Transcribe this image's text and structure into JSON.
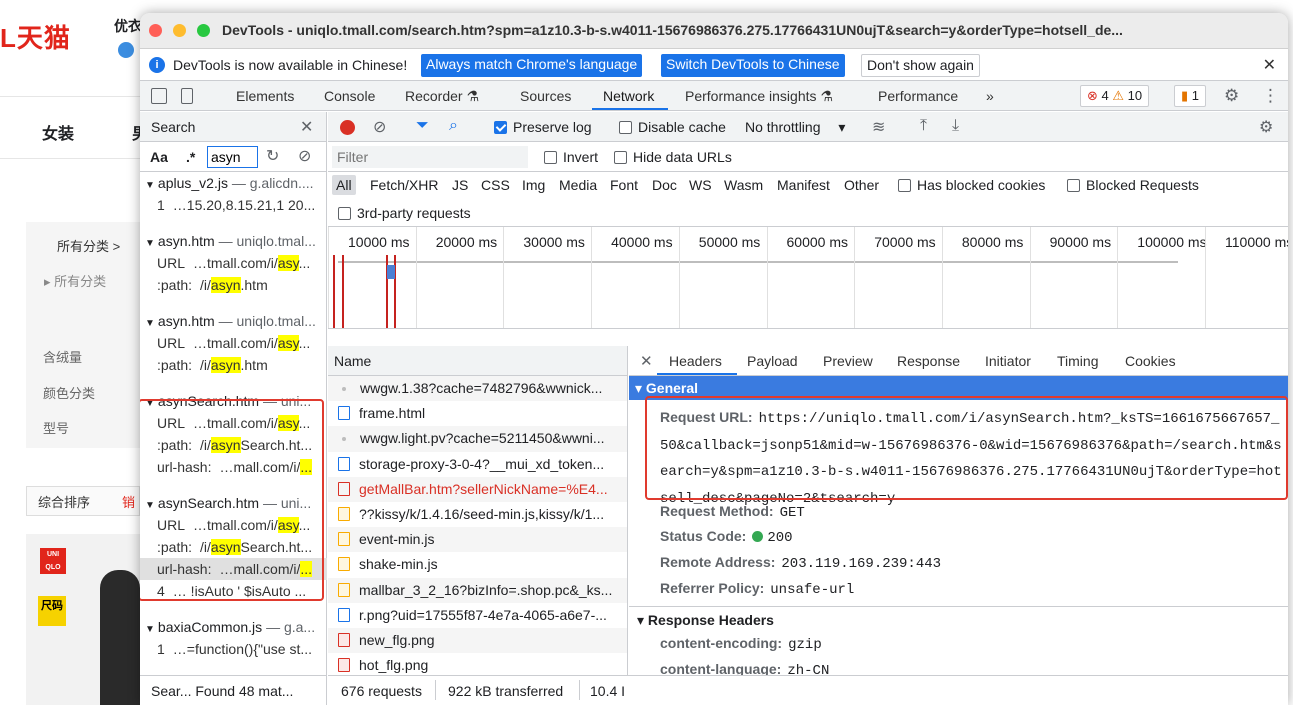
{
  "background": {
    "logo": "L天猫",
    "shop_name": "优衣",
    "nav": [
      "女装",
      "男"
    ],
    "category_title": "所有分类 >",
    "category_all": "所有分类",
    "filters": [
      "含绒量",
      "颜色分类",
      "型号"
    ],
    "sort_default": "综合排序",
    "sort_sales": "销",
    "product_tag": "尺码",
    "brand_badge": "UNI QLO"
  },
  "window": {
    "title": "DevTools - uniqlo.tmall.com/search.htm?spm=a1z10.3-b-s.w4011-15676986376.275.17766431UN0ujT&search=y&orderType=hotsell_de..."
  },
  "infobar": {
    "message": "DevTools is now available in Chinese!",
    "btn_match": "Always match Chrome's language",
    "btn_switch": "Switch DevTools to Chinese",
    "btn_dismiss": "Don't show again"
  },
  "tabs": {
    "items": [
      "Elements",
      "Console",
      "Recorder ⚗",
      "Sources",
      "Network",
      "Performance insights ⚗",
      "Performance"
    ],
    "more": "»",
    "errors": "4",
    "warnings": "10",
    "issues": "1"
  },
  "search": {
    "title": "Search",
    "aa": "Aa",
    "regex": ".*",
    "query": "asyn",
    "footer": "Sear...   Found 48 mat...",
    "results": [
      {
        "file": "aplus_v2.js",
        "url": "g.alicdn....",
        "lines": [
          {
            "k": "1",
            "pre": "…15.20,8.15.21,1 20...",
            "hl": "",
            "post": ""
          }
        ]
      },
      {
        "file": "asyn.htm",
        "url": "uniqlo.tmal...",
        "lines": [
          {
            "k": "URL",
            "pre": "…tmall.com/i/",
            "hl": "asy",
            "post": "..."
          },
          {
            "k": ":path:",
            "pre": "/i/",
            "hl": "asyn",
            "post": ".htm"
          }
        ]
      },
      {
        "file": "asyn.htm",
        "url": "uniqlo.tmal...",
        "lines": [
          {
            "k": "URL",
            "pre": "…tmall.com/i/",
            "hl": "asy",
            "post": "..."
          },
          {
            "k": ":path:",
            "pre": "/i/",
            "hl": "asyn",
            "post": ".htm"
          }
        ]
      },
      {
        "file": "asynSearch.htm",
        "url": "uni...",
        "lines": [
          {
            "k": "URL",
            "pre": "…tmall.com/i/",
            "hl": "asy",
            "post": "..."
          },
          {
            "k": ":path:",
            "pre": "/i/",
            "hl": "asyn",
            "post": "Search.ht..."
          },
          {
            "k": "url-hash:",
            "pre": "…mall.com/i/",
            "hl": "...",
            "post": ""
          }
        ]
      },
      {
        "file": "asynSearch.htm",
        "url": "uni...",
        "lines": [
          {
            "k": "URL",
            "pre": "…tmall.com/i/",
            "hl": "asy",
            "post": "..."
          },
          {
            "k": ":path:",
            "pre": "/i/",
            "hl": "asyn",
            "post": "Search.ht..."
          },
          {
            "k": "url-hash:",
            "pre": "…mall.com/i/",
            "hl": "...",
            "post": ""
          },
          {
            "k": "4",
            "pre": "… !isAuto ' $isAuto ...",
            "hl": "",
            "post": ""
          }
        ]
      },
      {
        "file": "baxiaCommon.js",
        "url": "g.a...",
        "lines": [
          {
            "k": "1",
            "pre": "…=function(){\"use st...",
            "hl": "",
            "post": ""
          }
        ]
      }
    ]
  },
  "network": {
    "preserve_log": "Preserve log",
    "disable_cache": "Disable cache",
    "throttling": "No throttling",
    "filter_placeholder": "Filter",
    "invert": "Invert",
    "hide_data": "Hide data URLs",
    "types": [
      "All",
      "Fetch/XHR",
      "JS",
      "CSS",
      "Img",
      "Media",
      "Font",
      "Doc",
      "WS",
      "Wasm",
      "Manifest",
      "Other"
    ],
    "blocked_cookies": "Has blocked cookies",
    "blocked_requests": "Blocked Requests",
    "third_party": "3rd-party requests",
    "ticks": [
      "10000 ms",
      "20000 ms",
      "30000 ms",
      "40000 ms",
      "50000 ms",
      "60000 ms",
      "70000 ms",
      "80000 ms",
      "90000 ms",
      "100000 ms",
      "110000 ms"
    ],
    "name_header": "Name",
    "requests": [
      {
        "type": "dot",
        "name": "wwgw.1.38?cache=7482796&wwnick..."
      },
      {
        "type": "doc",
        "name": "frame.html"
      },
      {
        "type": "dot",
        "name": "wwgw.light.pv?cache=5211450&wwni..."
      },
      {
        "type": "doc",
        "name": "storage-proxy-3-0-4?__mui_xd_token..."
      },
      {
        "type": "xhr",
        "name": "getMallBar.htm?sellerNickName=%E4...",
        "error": true
      },
      {
        "type": "js",
        "name": "??kissy/k/1.4.16/seed-min.js,kissy/k/1..."
      },
      {
        "type": "js",
        "name": "event-min.js"
      },
      {
        "type": "js",
        "name": "shake-min.js"
      },
      {
        "type": "js",
        "name": "mallbar_3_2_16?bizInfo=.shop.pc&_ks..."
      },
      {
        "type": "doc",
        "name": "r.png?uid=17555f87-4e7a-4065-a6e7-..."
      },
      {
        "type": "img",
        "name": "new_flg.png"
      },
      {
        "type": "img",
        "name": "hot_flg.png"
      }
    ],
    "footer": {
      "requests": "676 requests",
      "transferred": "922 kB transferred",
      "resources": "10.4 I"
    }
  },
  "detail": {
    "tabs": [
      "Headers",
      "Payload",
      "Preview",
      "Response",
      "Initiator",
      "Timing",
      "Cookies"
    ],
    "general_title": "▾ General",
    "request_url_key": "Request URL:",
    "request_url": "https://uniqlo.tmall.com/i/asynSearch.htm?_ksTS=1661675667657_50&callback=jsonp51&mid=w-15676986376-0&wid=15676986376&path=/search.htm&search=y&spm=a1z10.3-b-s.w4011-15676986376.275.17766431UN0ujT&orderType=hotsell_desc&pageNo=2&tsearch=y",
    "method_key": "Request Method:",
    "method": "GET",
    "status_key": "Status Code:",
    "status": "200",
    "remote_key": "Remote Address:",
    "remote": "203.119.169.239:443",
    "referrer_key": "Referrer Policy:",
    "referrer": "unsafe-url",
    "response_title": "▾ Response Headers",
    "resp_headers": [
      {
        "key": "content-encoding:",
        "val": "gzip"
      },
      {
        "key": "content-language:",
        "val": "zh-CN"
      }
    ]
  }
}
